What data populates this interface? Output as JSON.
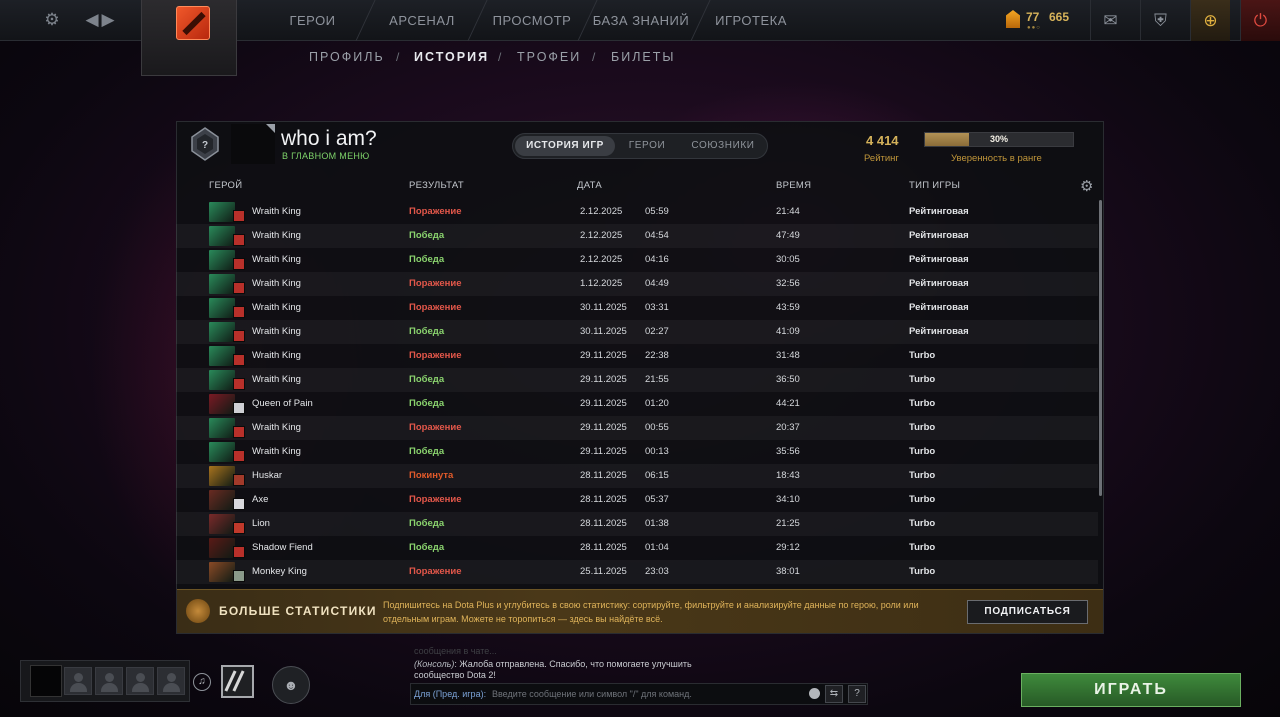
{
  "topnav": {
    "items": [
      "ГЕРОИ",
      "АРСЕНАЛ",
      "ПРОСМОТР",
      "БАЗА ЗНАНИЙ",
      "ИГРОТЕКА"
    ],
    "currency_a": "77",
    "currency_b": "665",
    "currency_dots": "●●○"
  },
  "subnav": {
    "items": [
      "ПРОФИЛЬ",
      "ИСТОРИЯ",
      "ТРОФЕИ",
      "БИЛЕТЫ"
    ],
    "active_index": 1,
    "separator": "/"
  },
  "profile": {
    "name": "who i am?",
    "status": "В ГЛАВНОМ МЕНЮ",
    "rating_value": "4 414",
    "rating_label": "Рейтинг",
    "confidence_percent": 30,
    "confidence_text": "30%",
    "confidence_label": "Уверенность в ранге"
  },
  "tabs": [
    "ИСТОРИЯ ИГР",
    "ГЕРОИ",
    "СОЮЗНИКИ"
  ],
  "active_tab": 0,
  "columns": {
    "hero": "ГЕРОЙ",
    "result": "РЕЗУЛЬТАТ",
    "date": "ДАТА",
    "duration": "ВРЕМЯ",
    "type": "ТИП ИГРЫ"
  },
  "matches": [
    {
      "hero": "Wraith King",
      "result": "Поражение",
      "status": "loss",
      "date": "2.12.2025",
      "time": "05:59",
      "duration": "21:44",
      "type": "Рейтинговая",
      "hero_color": "#2a8a5a",
      "badge_color": "#b8302a"
    },
    {
      "hero": "Wraith King",
      "result": "Победа",
      "status": "win",
      "date": "2.12.2025",
      "time": "04:54",
      "duration": "47:49",
      "type": "Рейтинговая",
      "hero_color": "#2a8a5a",
      "badge_color": "#b8302a"
    },
    {
      "hero": "Wraith King",
      "result": "Победа",
      "status": "win",
      "date": "2.12.2025",
      "time": "04:16",
      "duration": "30:05",
      "type": "Рейтинговая",
      "hero_color": "#2a8a5a",
      "badge_color": "#b8302a"
    },
    {
      "hero": "Wraith King",
      "result": "Поражение",
      "status": "loss",
      "date": "1.12.2025",
      "time": "04:49",
      "duration": "32:56",
      "type": "Рейтинговая",
      "hero_color": "#2a8a5a",
      "badge_color": "#b8302a"
    },
    {
      "hero": "Wraith King",
      "result": "Поражение",
      "status": "loss",
      "date": "30.11.2025",
      "time": "03:31",
      "duration": "43:59",
      "type": "Рейтинговая",
      "hero_color": "#2a8a5a",
      "badge_color": "#b8302a"
    },
    {
      "hero": "Wraith King",
      "result": "Победа",
      "status": "win",
      "date": "30.11.2025",
      "time": "02:27",
      "duration": "41:09",
      "type": "Рейтинговая",
      "hero_color": "#2a8a5a",
      "badge_color": "#b8302a"
    },
    {
      "hero": "Wraith King",
      "result": "Поражение",
      "status": "loss",
      "date": "29.11.2025",
      "time": "22:38",
      "duration": "31:48",
      "type": "Turbo",
      "hero_color": "#2a8a5a",
      "badge_color": "#b8302a"
    },
    {
      "hero": "Wraith King",
      "result": "Победа",
      "status": "win",
      "date": "29.11.2025",
      "time": "21:55",
      "duration": "36:50",
      "type": "Turbo",
      "hero_color": "#2a8a5a",
      "badge_color": "#b8302a"
    },
    {
      "hero": "Queen of Pain",
      "result": "Победа",
      "status": "win",
      "date": "29.11.2025",
      "time": "01:20",
      "duration": "44:21",
      "type": "Turbo",
      "hero_color": "#7a1a24",
      "badge_color": "#cfcfd4"
    },
    {
      "hero": "Wraith King",
      "result": "Поражение",
      "status": "loss",
      "date": "29.11.2025",
      "time": "00:55",
      "duration": "20:37",
      "type": "Turbo",
      "hero_color": "#2a8a5a",
      "badge_color": "#b8302a"
    },
    {
      "hero": "Wraith King",
      "result": "Победа",
      "status": "win",
      "date": "29.11.2025",
      "time": "00:13",
      "duration": "35:56",
      "type": "Turbo",
      "hero_color": "#2a8a5a",
      "badge_color": "#b8302a"
    },
    {
      "hero": "Huskar",
      "result": "Покинута",
      "status": "abandon",
      "date": "28.11.2025",
      "time": "06:15",
      "duration": "18:43",
      "type": "Turbo",
      "hero_color": "#a8741e",
      "badge_color": "#a23a2a"
    },
    {
      "hero": "Axe",
      "result": "Поражение",
      "status": "loss",
      "date": "28.11.2025",
      "time": "05:37",
      "duration": "34:10",
      "type": "Turbo",
      "hero_color": "#6a2b22",
      "badge_color": "#d8d8dc"
    },
    {
      "hero": "Lion",
      "result": "Победа",
      "status": "win",
      "date": "28.11.2025",
      "time": "01:38",
      "duration": "21:25",
      "type": "Turbo",
      "hero_color": "#7a2a2a",
      "badge_color": "#c0392b"
    },
    {
      "hero": "Shadow Fiend",
      "result": "Победа",
      "status": "win",
      "date": "28.11.2025",
      "time": "01:04",
      "duration": "29:12",
      "type": "Turbo",
      "hero_color": "#5a1a16",
      "badge_color": "#b8302a"
    },
    {
      "hero": "Monkey King",
      "result": "Поражение",
      "status": "loss",
      "date": "25.11.2025",
      "time": "23:03",
      "duration": "38:01",
      "type": "Turbo",
      "hero_color": "#8a4a26",
      "badge_color": "#8a9a8a"
    }
  ],
  "promo": {
    "title": "БОЛЬШЕ СТАТИСТИКИ",
    "text": "Подпишитесь на Dota Plus и углубитесь в свою статистику: сортируйте, фильтруйте и анализируйте данные по герою, роли или отдельным играм. Можете не торопиться — здесь вы найдёте всё.",
    "button": "ПОДПИСАТЬСЯ"
  },
  "chat": {
    "faded": "сообщения в чате...",
    "source": "(Консоль)",
    "message": "Жалоба отправлена. Спасибо, что помогаете улучшить",
    "message2": "сообщество Dota 2!",
    "prefix": "Для (Пред. игра):",
    "placeholder": "Введите сообщение или символ \"/\" для команд."
  },
  "play_button": "ИГРАТЬ",
  "icons": {
    "settings": "gear-icon",
    "nav_back": "arrow-left-icon",
    "nav_forward": "arrow-right-icon",
    "mail": "mail-icon",
    "armory": "shield-icon",
    "dota_plus": "plus-icon",
    "power": "power-icon"
  }
}
